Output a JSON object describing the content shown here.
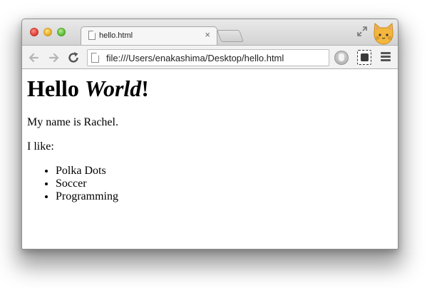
{
  "browser": {
    "tab": {
      "title": "hello.html",
      "close_glyph": "×"
    },
    "address_bar": {
      "url": "file:///Users/enakashima/Desktop/hello.html"
    },
    "icons": [
      "back-icon",
      "forward-icon",
      "reload-icon",
      "document-icon",
      "adblock-icon",
      "screenshot-extension-icon",
      "menu-icon",
      "fullscreen-icon",
      "cat-icon"
    ],
    "colors": {
      "titlebar": "#dcdcdc",
      "toolbar": "#f2f2f2",
      "close_light": "#e0443a",
      "min_light": "#e8b12d",
      "max_light": "#62be3b"
    }
  },
  "page": {
    "heading": {
      "part1": "Hello ",
      "part2": "World",
      "part3": "!"
    },
    "intro": "My name is Rachel.",
    "likes_label": "I like:",
    "likes": [
      "Polka Dots",
      "Soccer",
      "Programming"
    ]
  }
}
